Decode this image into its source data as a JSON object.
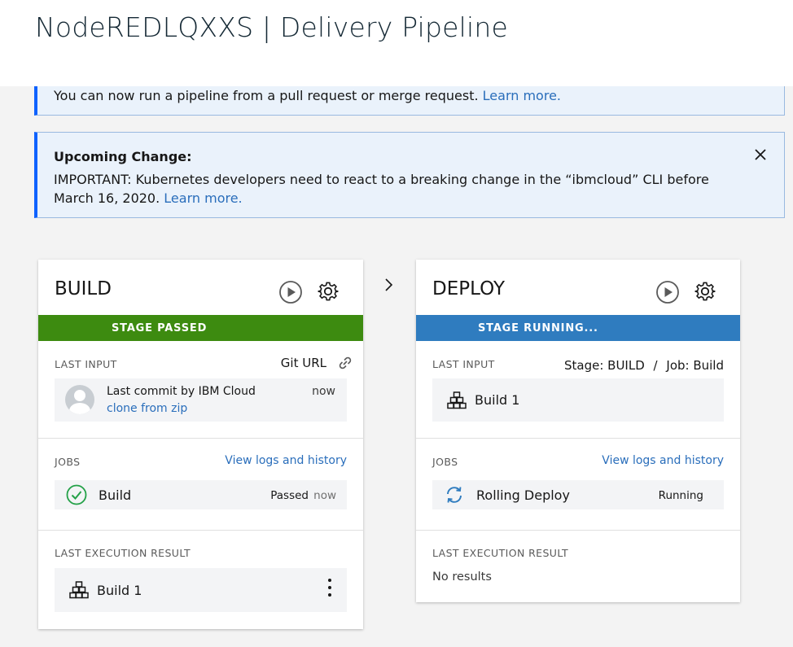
{
  "header": {
    "title": "NodeREDLQXXS | Delivery Pipeline"
  },
  "notices": {
    "pull_request": {
      "text": "You can now run a pipeline from a pull request or merge request.",
      "link": "Learn more."
    },
    "upcoming": {
      "title": "Upcoming Change:",
      "text": "IMPORTANT: Kubernetes developers need to react to a breaking change in the “ibmcloud” CLI before March 16, 2020.",
      "link": "Learn more."
    }
  },
  "stages": {
    "build": {
      "name": "BUILD",
      "status": "STAGE PASSED",
      "status_color": "#3d8b10",
      "last_input_label": "LAST INPUT",
      "input_source": "Git URL",
      "commit_text": "Last commit by IBM Cloud",
      "commit_time": "now",
      "commit_link": "clone from zip",
      "jobs_label": "JOBS",
      "logs_link": "View logs and history",
      "job_name": "Build",
      "job_status": "Passed",
      "job_time": "now",
      "last_exec_label": "LAST EXECUTION RESULT",
      "exec_result": "Build 1"
    },
    "deploy": {
      "name": "DEPLOY",
      "status": "STAGE RUNNING...",
      "status_color": "#2f7cbf",
      "last_input_label": "LAST INPUT",
      "input_stage": "Stage: BUILD",
      "input_sep": "/",
      "input_job": "Job: Build",
      "input_build": "Build 1",
      "jobs_label": "JOBS",
      "logs_link": "View logs and history",
      "job_name": "Rolling Deploy",
      "job_status": "Running",
      "last_exec_label": "LAST EXECUTION RESULT",
      "exec_result": "No results"
    }
  },
  "icons": {
    "play": "play-circle-icon",
    "gear": "gear-icon",
    "link": "link-icon",
    "check": "check-circle-icon",
    "refresh": "refresh-icon",
    "build": "build-blocks-icon",
    "more": "overflow-menu-icon",
    "close": "close-icon",
    "chevron": "chevron-right-icon"
  }
}
